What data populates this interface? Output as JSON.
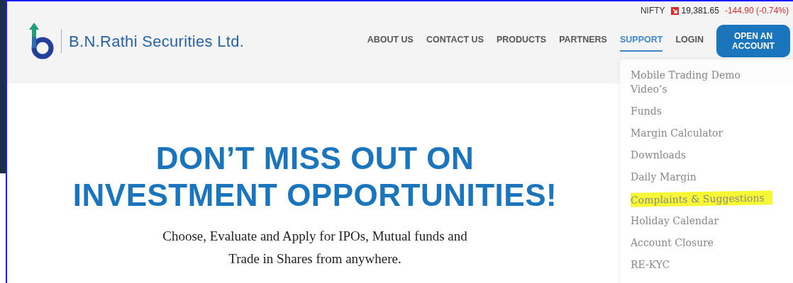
{
  "ticker": {
    "label": "NIFTY",
    "value": "19,381.65",
    "change": "-144.90 (-0.74%)"
  },
  "brand": {
    "name": "B.N.Rathi Securities Ltd."
  },
  "nav": [
    {
      "label": "ABOUT US",
      "selected": false
    },
    {
      "label": "CONTACT US",
      "selected": false
    },
    {
      "label": "PRODUCTS",
      "selected": false
    },
    {
      "label": "PARTNERS",
      "selected": false
    },
    {
      "label": "SUPPORT",
      "selected": true
    },
    {
      "label": "LOGIN",
      "selected": false
    }
  ],
  "cta": {
    "label": "OPEN AN ACCOUNT"
  },
  "hero": {
    "headline_lines": [
      "DON’T MISS OUT ON",
      "INVESTMENT OPPORTUNITIES!"
    ],
    "subtitle_lines": [
      "Choose, Evaluate and Apply for IPOs, Mutual funds and",
      "Trade in Shares from anywhere."
    ]
  },
  "support_menu": [
    {
      "label": "Mobile Trading Demo Video’s",
      "highlighted": false
    },
    {
      "label": "Funds",
      "highlighted": false
    },
    {
      "label": "Margin Calculator",
      "highlighted": false
    },
    {
      "label": "Downloads",
      "highlighted": false
    },
    {
      "label": "Daily Margin",
      "highlighted": false
    },
    {
      "label": "Complaints & Suggestions",
      "highlighted": true
    },
    {
      "label": "Holiday Calendar",
      "highlighted": false
    },
    {
      "label": "Account Closure",
      "highlighted": false
    },
    {
      "label": "RE-KYC",
      "highlighted": false
    }
  ]
}
